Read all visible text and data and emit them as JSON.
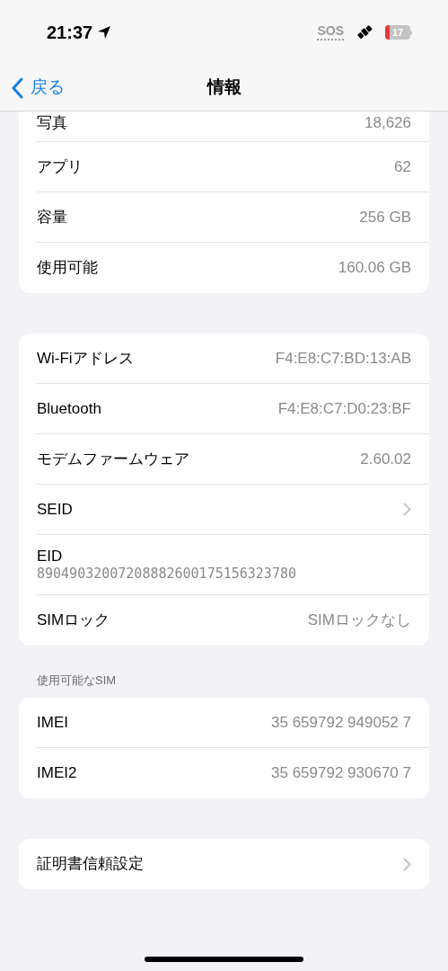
{
  "status_bar": {
    "time": "21:37",
    "sos": "SOS",
    "battery": "17"
  },
  "nav": {
    "back": "戻る",
    "title": "情報"
  },
  "groups": [
    {
      "rows": [
        {
          "kind": "value",
          "label": "写真",
          "value": "18,626"
        },
        {
          "kind": "value",
          "label": "アプリ",
          "value": "62"
        },
        {
          "kind": "value",
          "label": "容量",
          "value": "256 GB"
        },
        {
          "kind": "value",
          "label": "使用可能",
          "value": "160.06 GB"
        }
      ]
    },
    {
      "rows": [
        {
          "kind": "value",
          "label": "Wi-Fiアドレス",
          "value": "F4:E8:C7:BD:13:AB"
        },
        {
          "kind": "value",
          "label": "Bluetooth",
          "value": "F4:E8:C7:D0:23:BF"
        },
        {
          "kind": "value",
          "label": "モデムファームウェア",
          "value": "2.60.02"
        },
        {
          "kind": "link",
          "label": "SEID"
        },
        {
          "kind": "stacked",
          "label": "EID",
          "value": "89049032007208882600175156323780"
        },
        {
          "kind": "value",
          "label": "SIMロック",
          "value": "SIMロックなし"
        }
      ]
    },
    {
      "header": "使用可能なSIM",
      "rows": [
        {
          "kind": "value",
          "label": "IMEI",
          "value": "35 659792 949052 7"
        },
        {
          "kind": "value",
          "label": "IMEI2",
          "value": "35 659792 930670 7"
        }
      ]
    },
    {
      "rows": [
        {
          "kind": "link",
          "label": "証明書信頼設定"
        }
      ]
    }
  ]
}
